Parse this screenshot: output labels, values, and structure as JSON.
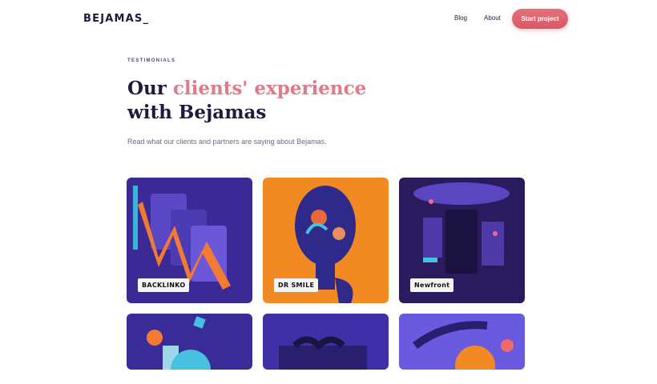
{
  "header": {
    "logo": "BEJAMAS_",
    "nav": [
      {
        "label": "Blog"
      },
      {
        "label": "About"
      }
    ],
    "cta_label": "Start project"
  },
  "hero": {
    "eyebrow": "TESTIMONIALS",
    "title_part1": "Our ",
    "title_accent": "clients' experience",
    "title_part2": "with Bejamas",
    "subtitle": "Read what our clients and partners are saying about Bejamas."
  },
  "cards": [
    {
      "badge": "BACKLINKO",
      "bg": "#3d2a9a"
    },
    {
      "badge": "DR SMILE",
      "bg": "#f48a22"
    },
    {
      "badge": "Newfront",
      "bg": "#2a1a5c"
    },
    {
      "badge": "",
      "bg": "#3a2c98"
    },
    {
      "badge": "",
      "bg": "#4030a8"
    },
    {
      "badge": "",
      "bg": "#6a5ae0"
    }
  ],
  "colors": {
    "brand_dark": "#1f1b3d",
    "accent_pink": "#e07a8a",
    "cta": "#d85866"
  }
}
